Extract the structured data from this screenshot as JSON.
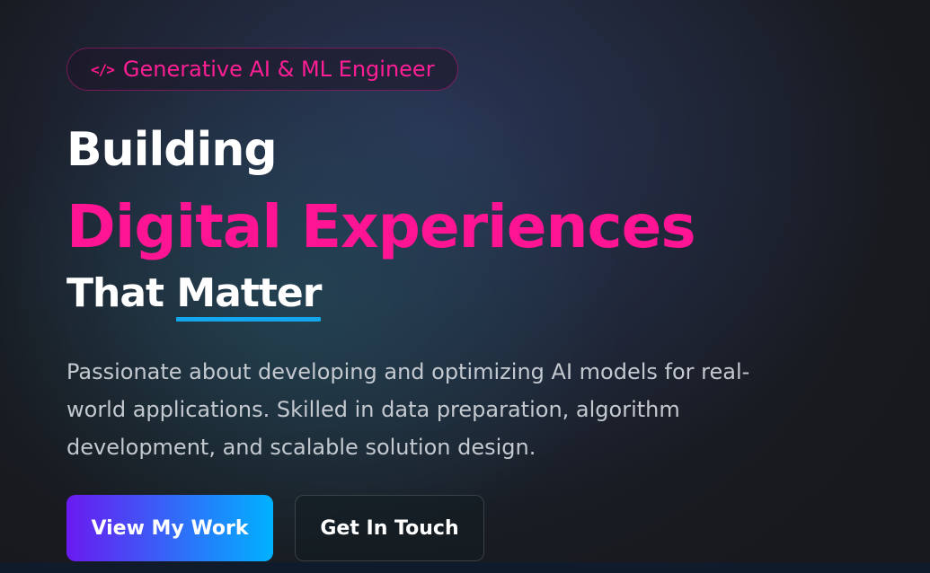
{
  "badge": {
    "icon": "code-icon",
    "icon_glyph": "</>",
    "label": "Generative AI & ML Engineer"
  },
  "headline": {
    "line1": "Building",
    "line2": "Digital Experiences",
    "line3_prefix": "That ",
    "line3_highlight": "Matter"
  },
  "description": "Passionate about developing and optimizing AI models for real-world applications. Skilled in data preparation, algorithm development, and scalable solution design.",
  "buttons": {
    "primary_label": "View My Work",
    "secondary_label": "Get In Touch"
  },
  "colors": {
    "accent_pink": "#ff1493",
    "underline_blue": "#14a7ee",
    "gradient_start": "#6a1af0",
    "gradient_end": "#00b2ff"
  }
}
